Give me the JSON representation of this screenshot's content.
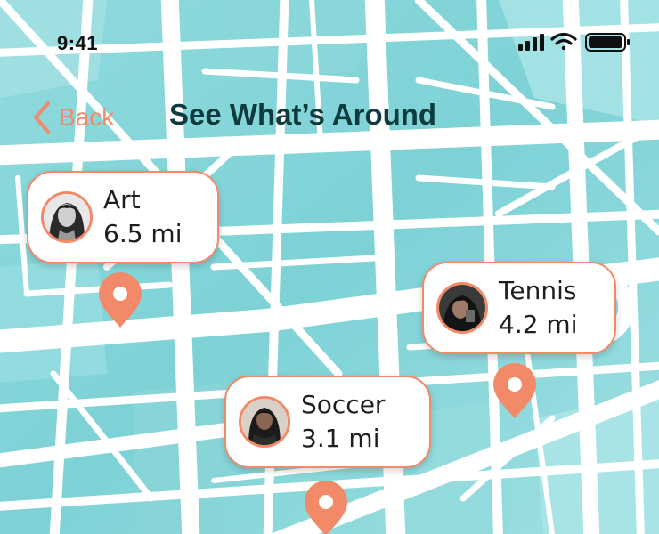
{
  "status_bar": {
    "time": "9:41"
  },
  "nav": {
    "back_label": "Back",
    "title": "See What’s Around"
  },
  "places": [
    {
      "name": "Art",
      "distance": "6.5 mi",
      "avatar_icon": "person-photo-bw"
    },
    {
      "name": "Tennis",
      "distance": "4.2 mi",
      "avatar_icon": "person-photo-dark"
    },
    {
      "name": "Soccer",
      "distance": "3.1 mi",
      "avatar_icon": "person-photo-dark"
    }
  ],
  "colors": {
    "accent": "#f28a6a",
    "map_water": "#7fd4d8",
    "map_roads": "#ffffff",
    "title": "#0e3b3d"
  },
  "icons": {
    "back": "chevron-left-icon",
    "pin": "map-pin-icon",
    "signal": "signal-icon",
    "wifi": "wifi-icon",
    "battery": "battery-icon"
  }
}
